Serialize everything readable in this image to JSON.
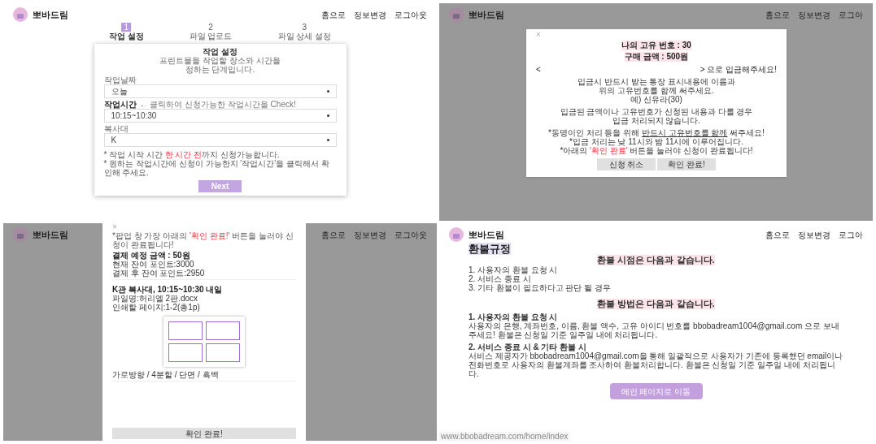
{
  "panels": [
    {
      "kind": "step_form",
      "dimmed": false,
      "header": {
        "logo": "뽀바드림",
        "nav": [
          "홈으로",
          "정보변경",
          "로그아웃"
        ]
      },
      "steps": [
        {
          "number": "1",
          "label": "작업 설정",
          "selected": true
        },
        {
          "number": "2",
          "label": "파일 업로드",
          "selected": false
        },
        {
          "number": "3",
          "label": "파일 상세 설정",
          "selected": false
        }
      ],
      "card": {
        "title": "작업 설정",
        "description": [
          "프린트물을 작업할 장소와 시간을",
          "정하는 단계입니다."
        ],
        "fields": [
          {
            "label": "작업날짜",
            "value": "오늘"
          },
          {
            "label": "작업시간",
            "hint": "← 클릭하여 신청가능한 작업시간을 Check!",
            "value": "10:15~10:30"
          },
          {
            "label": "복사대",
            "value": "K"
          }
        ],
        "notes": [
          [
            {
              "text": "* 작업 시작 시간 ",
              "kind": "plain"
            },
            {
              "text": "한 시간 전",
              "kind": "red"
            },
            {
              "text": "까지 신청가능합니다.",
              "kind": "plain"
            }
          ],
          [
            {
              "text": "* 원하는 작업시간에 신청이 가능한지 '작업시간'을 클릭해서 확인해 주세요.",
              "kind": "plain"
            }
          ]
        ],
        "button": "Next"
      }
    },
    {
      "kind": "deposit_modal",
      "dimmed": true,
      "header": {
        "logo": "뽀바드림",
        "nav": [
          "홈으로",
          "정보변경",
          "로그아"
        ]
      },
      "modal": {
        "close": "×",
        "headings": [
          "나의 고유 번호 : 30",
          "구매 금액 : 500원"
        ],
        "account": {
          "open": "<",
          "close": "> 으로 입금해주세요!"
        },
        "paragraphs": [
          [
            "입금시 반드시 받는 통장 표시내용에 이름과",
            "위의 고유번호를 함께 써주세요.",
            "예) 신유라(30)"
          ],
          [
            "입금된 금액이나 고유번호가 신청된 내용과 다를 경우",
            "입금 처리되지 않습니다."
          ]
        ],
        "notes": [
          [
            {
              "text": "*동명이인 처리 등을 위해 ",
              "kind": "plain"
            },
            {
              "text": "반드시 고유번호를 함께",
              "kind": "underline"
            },
            {
              "text": " 써주세요!",
              "kind": "plain"
            }
          ],
          [
            {
              "text": "*입금 처리는 낮 11시와 밤 11시에 이루어집니다.",
              "kind": "plain"
            }
          ],
          [
            {
              "text": "*아래의 ",
              "kind": "plain"
            },
            {
              "text": "'확인 완료'",
              "kind": "red"
            },
            {
              "text": " 버튼을 눌러야 신청이 완료됩니다!",
              "kind": "plain"
            }
          ]
        ],
        "buttons": [
          "신청 취소",
          "확인 완료!"
        ]
      }
    },
    {
      "kind": "confirm_modal",
      "dimmed": true,
      "header": {
        "logo": "뽀바드림",
        "nav": [
          "홈으로",
          "정보변경",
          "로그아웃"
        ]
      },
      "modal": {
        "close": "×",
        "notice": [
          {
            "text": "*팝업 창 가장 아래의 ",
            "kind": "plain"
          },
          {
            "text": "'확인 완료!'",
            "kind": "red"
          },
          {
            "text": " 버튼을 눌러야 신청이 완료됩니다!",
            "kind": "plain"
          }
        ],
        "payment": {
          "title": "결제 예정 금액 : 50원",
          "lines": [
            "현재 잔여 포인트:3000",
            "결제 후 잔여 포인트:2950"
          ]
        },
        "job": {
          "title": "K관 복사대, 10:15~10:30 내일",
          "lines": [
            "파일명:허리엘 2판.docx",
            "인쇄할 페이지:1-2(총1p)"
          ]
        },
        "settings": "가로방향 / 4분할 / 단면 / 흑백",
        "button": "확인 완료!"
      }
    },
    {
      "kind": "refund_policy",
      "dimmed": false,
      "header": {
        "logo": "뽀바드림",
        "nav": [
          "홈으로",
          "정보변경",
          "로그아"
        ]
      },
      "title": "환불규정",
      "timing_heading": "환불 시점은 다음과 같습니다.",
      "timing_items": [
        "1. 사용자의 환불 요청 시",
        "2. 서비스 종료 시",
        "3. 기타 환불이 필요하다고 판단 될 경우"
      ],
      "method_heading": "환불 방법은 다음과 같습니다.",
      "methods": [
        {
          "title": "1. 사용자의 환불 요청 시",
          "body": "사용자의 은행, 계좌번호, 이름, 환불 액수, 고유 아이디 번호를 bbobadream1004@gmail.com 으로 보내주세요! 환불은 신청일 기준 일주일 내에 처리됩니다."
        },
        {
          "title": "2. 서비스 종료 시 & 기타 환불 시",
          "body": "서비스 제공자가 bbobadream1004@gmail.com을 통해 일괄적으로 사용자가 기존에 등록했던 email이나 전화번호로 사용자의 환불계좌를 조사하여 환불처리합니다. 환불은 신청일 기준 일주일 내에 처리됩니다."
        }
      ],
      "button": "메인 페이지로 이동",
      "status_url": "www.bbobadream.com/home/index"
    }
  ]
}
